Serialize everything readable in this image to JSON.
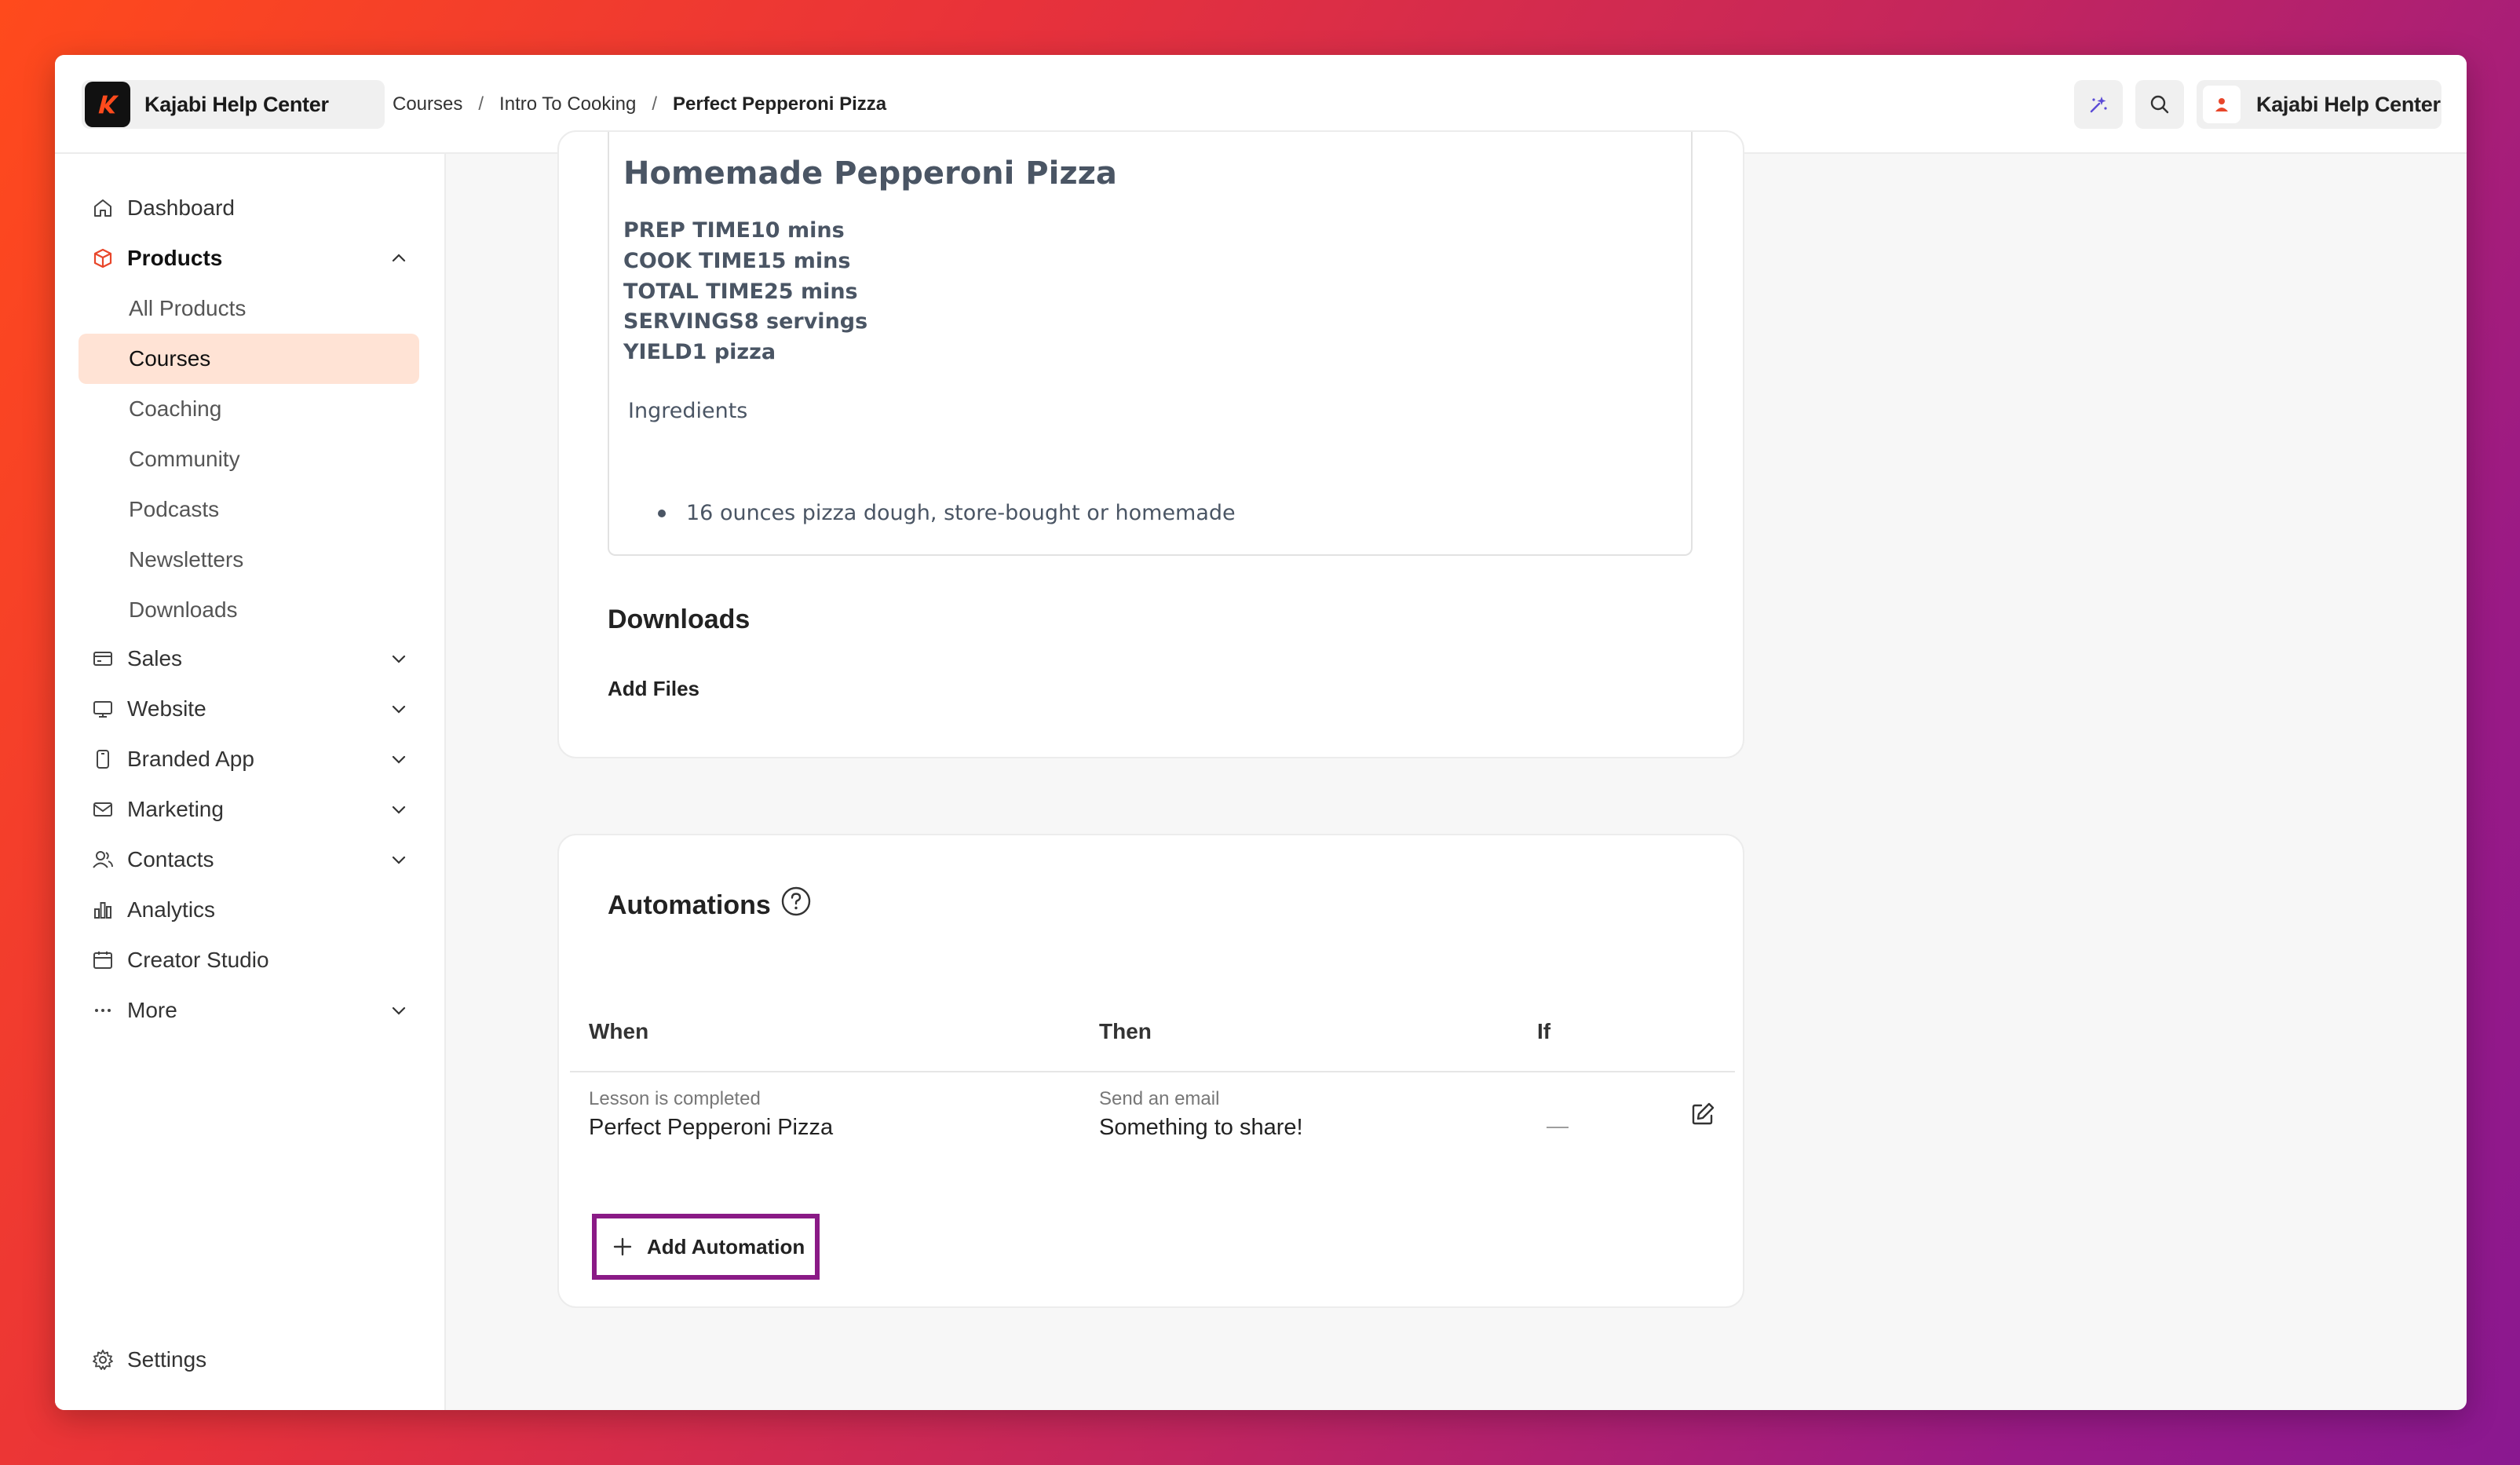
{
  "header": {
    "brand": "Kajabi Help Center",
    "breadcrumb": [
      "Courses",
      "Intro To Cooking",
      "Perfect Pepperoni Pizza"
    ],
    "account_name": "Kajabi Help Center"
  },
  "sidebar": {
    "dashboard": "Dashboard",
    "products": "Products",
    "products_sub": [
      "All Products",
      "Courses",
      "Coaching",
      "Community",
      "Podcasts",
      "Newsletters",
      "Downloads"
    ],
    "sales": "Sales",
    "website": "Website",
    "branded_app": "Branded App",
    "marketing": "Marketing",
    "contacts": "Contacts",
    "analytics": "Analytics",
    "creator_studio": "Creator Studio",
    "more": "More",
    "settings": "Settings"
  },
  "recipe": {
    "title": "Homemade Pepperoni Pizza",
    "meta": [
      "PREP TIME10 mins",
      "COOK TIME15 mins",
      "TOTAL TIME25 mins",
      "SERVINGS8 servings",
      "YIELD1 pizza"
    ],
    "ingredients_label": "Ingredients",
    "ingredient_items": [
      "16 ounces pizza dough, store-bought or homemade"
    ]
  },
  "downloads": {
    "title": "Downloads",
    "add_files": "Add Files"
  },
  "automations": {
    "title": "Automations",
    "columns": [
      "When",
      "Then",
      "If"
    ],
    "row": {
      "when_sub": "Lesson is completed",
      "when_main": "Perfect Pepperoni Pizza",
      "then_sub": "Send an email",
      "then_main": "Something to share!",
      "if": "—"
    },
    "add_button": "Add Automation"
  },
  "colors": {
    "accent": "#e8462a",
    "selected_bg": "#ffe3d5",
    "highlight_border": "#8a1a86"
  }
}
